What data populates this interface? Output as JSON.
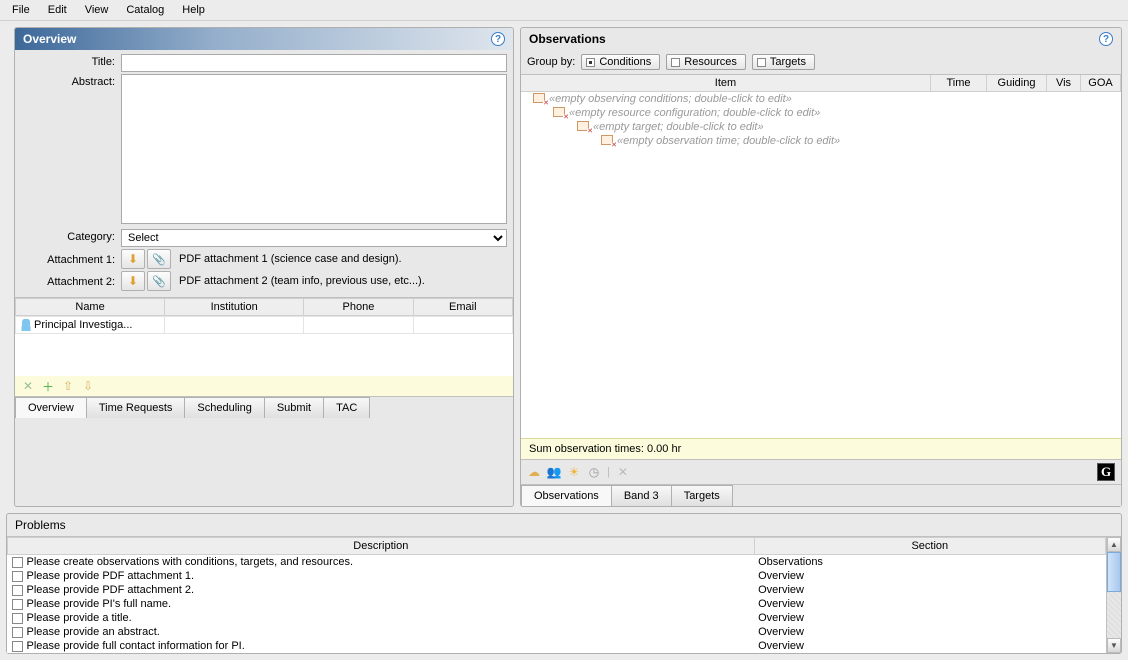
{
  "menu": {
    "items": [
      "File",
      "Edit",
      "View",
      "Catalog",
      "Help"
    ]
  },
  "overview_panel": {
    "title": "Overview",
    "labels": {
      "title": "Title:",
      "abstract": "Abstract:",
      "category": "Category:",
      "attachment1": "Attachment 1:",
      "attachment2": "Attachment 2:"
    },
    "fields": {
      "title": "",
      "abstract": "",
      "category_selected": "Select",
      "attachment1_desc": "PDF attachment 1 (science case and design).",
      "attachment2_desc": "PDF attachment 2 (team info, previous use, etc...)."
    },
    "investigators": {
      "columns": [
        "Name",
        "Institution",
        "Phone",
        "Email"
      ],
      "rows": [
        {
          "name": "Principal Investiga...",
          "institution": "",
          "phone": "",
          "email": ""
        }
      ]
    },
    "toolstrip_icons": [
      "delete-icon",
      "add-icon",
      "move-up-icon",
      "move-down-icon"
    ],
    "tabs": [
      "Overview",
      "Time Requests",
      "Scheduling",
      "Submit",
      "TAC"
    ]
  },
  "observations_panel": {
    "title": "Observations",
    "group_by_label": "Group by:",
    "group_by_options": [
      "Conditions",
      "Resources",
      "Targets"
    ],
    "group_by_active": "Conditions",
    "columns": [
      "Item",
      "Time",
      "Guiding",
      "Vis",
      "GOA"
    ],
    "tree": [
      {
        "level": 1,
        "text": "«empty observing conditions; double-click to edit»"
      },
      {
        "level": 2,
        "text": "«empty resource configuration; double-click to edit»"
      },
      {
        "level": 3,
        "text": "«empty target; double-click to edit»"
      },
      {
        "level": 4,
        "text": "«empty observation time; double-click to edit»"
      }
    ],
    "sum_label": "Sum observation times: 0.00 hr",
    "toolstrip_icons": [
      "cloud-icon",
      "group-icon",
      "sun-icon",
      "clock-icon",
      "separator",
      "delete-icon"
    ],
    "tabs": [
      "Observations",
      "Band 3",
      "Targets"
    ]
  },
  "problems_panel": {
    "title": "Problems",
    "columns": [
      "Description",
      "Section"
    ],
    "rows": [
      {
        "desc": "Please create observations with conditions, targets, and resources.",
        "section": "Observations"
      },
      {
        "desc": "Please provide PDF attachment 1.",
        "section": "Overview"
      },
      {
        "desc": "Please provide PDF attachment 2.",
        "section": "Overview"
      },
      {
        "desc": "Please provide PI's full name.",
        "section": "Overview"
      },
      {
        "desc": "Please provide a title.",
        "section": "Overview"
      },
      {
        "desc": "Please provide an abstract.",
        "section": "Overview"
      },
      {
        "desc": "Please provide full contact information for PI.",
        "section": "Overview"
      }
    ]
  }
}
